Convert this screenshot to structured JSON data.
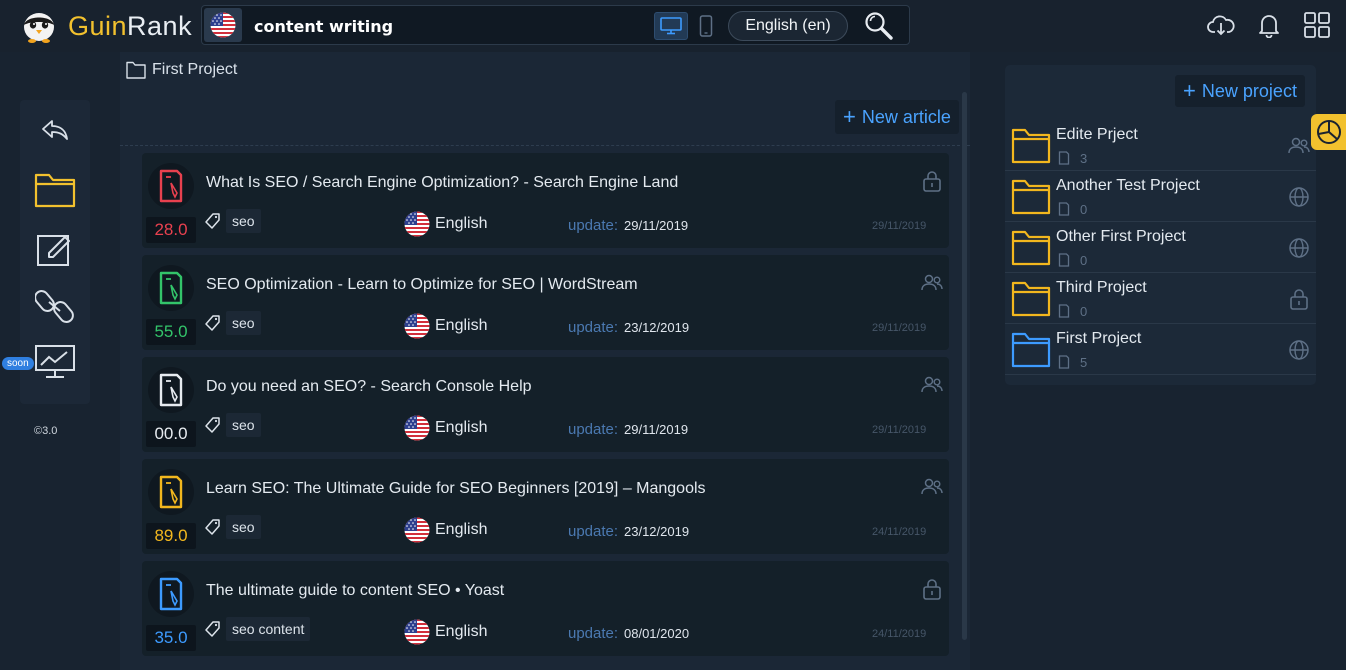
{
  "app": {
    "name_part1": "Guin",
    "name_part2": "Rank"
  },
  "search": {
    "query": "content writing",
    "language_label": "English (en)"
  },
  "breadcrumb": {
    "project": "First Project"
  },
  "actions": {
    "new_article": "New article",
    "new_project": "New project"
  },
  "rail": {
    "soon_badge": "soon",
    "version": "©3.0"
  },
  "articles": [
    {
      "title": "What Is SEO / Search Engine Optimization? - Search Engine Land",
      "score": "28.0",
      "score_color": "#e8414f",
      "tag": "seo",
      "language": "English",
      "update_label": "update:",
      "update_date": "29/11/2019",
      "created_date": "29/11/2019",
      "access": "lock-icon"
    },
    {
      "title": "SEO Optimization - Learn to Optimize for SEO | WordStream",
      "score": "55.0",
      "score_color": "#33c46a",
      "tag": "seo",
      "language": "English",
      "update_label": "update:",
      "update_date": "23/12/2019",
      "created_date": "29/11/2019",
      "access": "users-icon"
    },
    {
      "title": "Do you need an SEO? - Search Console Help",
      "score": "00.0",
      "score_color": "#e7ebf0",
      "tag": "seo",
      "language": "English",
      "update_label": "update:",
      "update_date": "29/11/2019",
      "created_date": "29/11/2019",
      "access": "users-icon"
    },
    {
      "title": "Learn SEO: The Ultimate Guide for SEO Beginners [2019] – Mangools",
      "score": "89.0",
      "score_color": "#f2b71e",
      "tag": "seo",
      "language": "English",
      "update_label": "update:",
      "update_date": "23/12/2019",
      "created_date": "24/11/2019",
      "access": "users-icon"
    },
    {
      "title": "The ultimate guide to content SEO • Yoast",
      "score": "35.0",
      "score_color": "#3d9bff",
      "tag": "seo content",
      "language": "English",
      "update_label": "update:",
      "update_date": "08/01/2020",
      "created_date": "24/11/2019",
      "access": "lock-icon"
    }
  ],
  "projects": [
    {
      "name": "Edite Prject",
      "count": "3",
      "folder_color": "#f2b71e",
      "access": "users-icon"
    },
    {
      "name": "Another Test Project",
      "count": "0",
      "folder_color": "#f2b71e",
      "access": "globe-icon"
    },
    {
      "name": "Other First Project",
      "count": "0",
      "folder_color": "#f2b71e",
      "access": "globe-icon"
    },
    {
      "name": "Third Project",
      "count": "0",
      "folder_color": "#f2b71e",
      "access": "lock-icon"
    },
    {
      "name": "First Project",
      "count": "5",
      "folder_color": "#3d9bff",
      "access": "globe-icon"
    }
  ],
  "colors": {
    "accent_blue": "#4aa3ff",
    "accent_yellow": "#f2c12e",
    "background": "#182330"
  }
}
